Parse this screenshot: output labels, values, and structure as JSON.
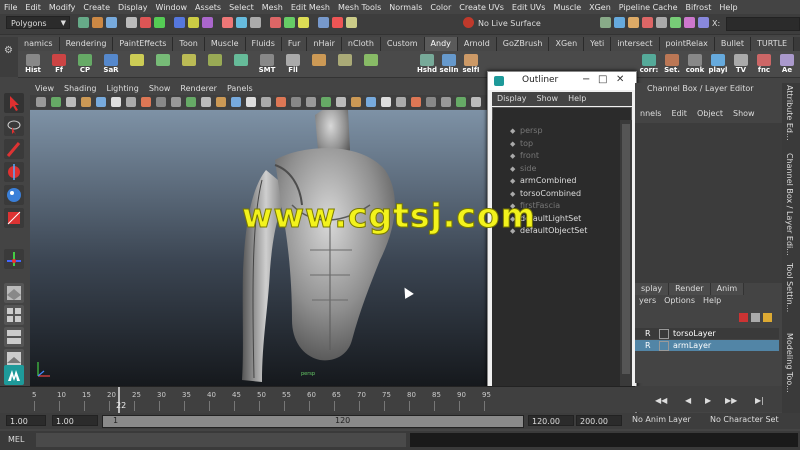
{
  "menubar": [
    "File",
    "Edit",
    "Modify",
    "Create",
    "Display",
    "Window",
    "Assets",
    "Select",
    "Mesh",
    "Edit Mesh",
    "Mesh Tools",
    "Normals",
    "Color",
    "Create UVs",
    "Edit UVs",
    "Muscle",
    "XGen",
    "Pipeline Cache",
    "Bifrost",
    "Help"
  ],
  "status": {
    "mode": "Polygons",
    "live_surface": "No Live Surface",
    "x_label": "X:"
  },
  "shelf_tabs": [
    "namics",
    "Rendering",
    "PaintEffects",
    "Toon",
    "Muscle",
    "Fluids",
    "Fur",
    "nHair",
    "nCloth",
    "Custom",
    "Andy",
    "Arnold",
    "GoZBrush",
    "XGen",
    "Yeti",
    "intersect",
    "pointRelax",
    "Bullet",
    "TURTLE"
  ],
  "shelf_active": "Andy",
  "shelf_tools_left": [
    "Hist",
    "Ff",
    "CP",
    "SaR",
    "",
    "",
    "",
    "",
    "",
    "SMT",
    "Fll",
    "",
    "",
    ""
  ],
  "shelf_tools_mid": [
    "Hshd",
    "selIn",
    "selfI"
  ],
  "shelf_tools_right": [
    "corr:",
    "Set.",
    "conk",
    "playl",
    "TV",
    "fnc",
    "Ae"
  ],
  "panel_menu": [
    "View",
    "Shading",
    "Lighting",
    "Show",
    "Renderer",
    "Panels"
  ],
  "outliner": {
    "title": "Outliner",
    "menu": [
      "Display",
      "Show",
      "Help"
    ],
    "items": [
      {
        "label": "persp",
        "dim": true
      },
      {
        "label": "top",
        "dim": true
      },
      {
        "label": "front",
        "dim": true
      },
      {
        "label": "side",
        "dim": true
      },
      {
        "label": "armCombined",
        "dim": false
      },
      {
        "label": "torsoCombined",
        "dim": false
      },
      {
        "label": "firstFascia",
        "dim": true
      },
      {
        "label": "defaultLightSet",
        "dim": false
      },
      {
        "label": "defaultObjectSet",
        "dim": false
      }
    ]
  },
  "channel_box": {
    "title": "Channel Box / Layer Editor",
    "menu": [
      "nnels",
      "Edit",
      "Object",
      "Show"
    ]
  },
  "side_tabs": [
    "Attribute Ed...",
    "Channel Box / Layer Edi...",
    "Tool Settin...",
    "Modeling Too..."
  ],
  "layer_editor": {
    "tabs": [
      "splay",
      "Render",
      "Anim"
    ],
    "menu": [
      "yers",
      "Options",
      "Help"
    ],
    "layers": [
      {
        "flag": "R",
        "name": "torsoLayer",
        "selected": false
      },
      {
        "flag": "R",
        "name": "armLayer",
        "selected": true
      }
    ]
  },
  "timeline": {
    "ticks": [
      "5",
      "10",
      "15",
      "20",
      "25",
      "30",
      "35",
      "40",
      "45",
      "50",
      "55",
      "60",
      "65",
      "70",
      "75",
      "80",
      "85",
      "90",
      "95"
    ],
    "current": "22"
  },
  "range": {
    "start": "1.00",
    "start2": "1.00",
    "slider_start": "1",
    "slider_end": "120",
    "end": "120.00",
    "end2": "200.00",
    "anim_layer": "No Anim Layer",
    "char_set": "No Character Set"
  },
  "cmdline": {
    "label": "MEL"
  },
  "viewport": {
    "camera_label": "persp"
  },
  "watermark": "www.cgtsj.com"
}
